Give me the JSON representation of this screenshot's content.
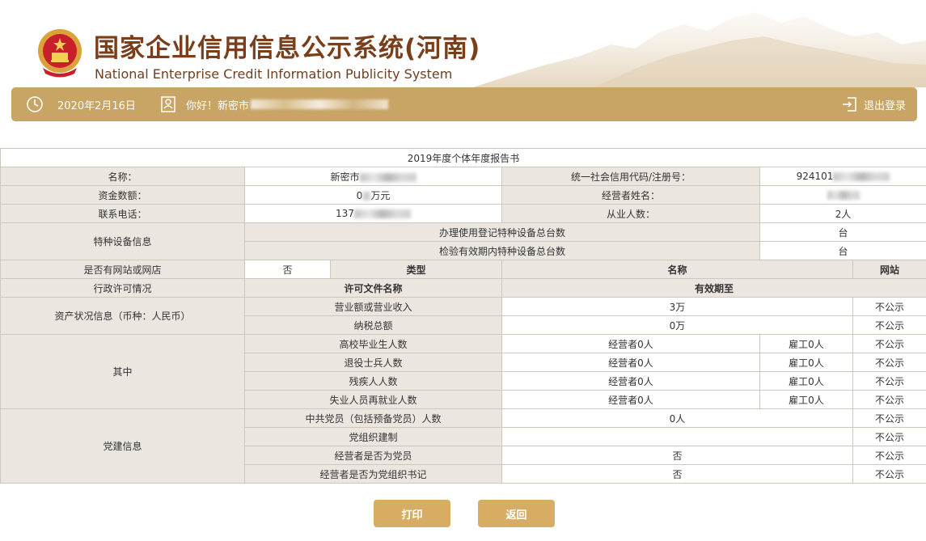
{
  "header": {
    "title_cn": "国家企业信用信息公示系统(河南)",
    "title_en": "National Enterprise Credit Information Publicity System"
  },
  "topbar": {
    "date": "2020年2月16日",
    "greeting": "你好！新密市",
    "logout": "退出登录"
  },
  "report": {
    "caption": "2019年度个体年度报告书",
    "name_label": "名称：",
    "name_value": "新密市",
    "credit_code_label": "统一社会信用代码/注册号：",
    "credit_code_value": "924101",
    "capital_label": "资金数额：",
    "capital_value_prefix": "0",
    "capital_value_suffix": "万元",
    "operator_label": "经营者姓名：",
    "phone_label": "联系电话：",
    "phone_value": "137",
    "employees_label": "从业人数：",
    "employees_value": "2人",
    "special_equipment_label": "特种设备信息",
    "special_equipment_rows": [
      {
        "label": "办理使用登记特种设备总台数",
        "value": "台"
      },
      {
        "label": "检验有效期内特种设备总台数",
        "value": "台"
      }
    ],
    "website_label": "是否有网站或网店",
    "website_value": "否",
    "website_headers": [
      "类型",
      "名称",
      "网站"
    ],
    "license_label": "行政许可情况",
    "license_headers": [
      "许可文件名称",
      "有效期至"
    ],
    "assets_label": "资产状况信息（币种：人民币）",
    "assets_rows": [
      {
        "label": "营业额或营业收入",
        "value": "3万",
        "status": "不公示"
      },
      {
        "label": "纳税总额",
        "value": "0万",
        "status": "不公示"
      }
    ],
    "among_label": "其中",
    "among_rows": [
      {
        "label": "高校毕业生人数",
        "operator": "经营者0人",
        "employee": "雇工0人",
        "status": "不公示"
      },
      {
        "label": "退役士兵人数",
        "operator": "经营者0人",
        "employee": "雇工0人",
        "status": "不公示"
      },
      {
        "label": "残疾人人数",
        "operator": "经营者0人",
        "employee": "雇工0人",
        "status": "不公示"
      },
      {
        "label": "失业人员再就业人数",
        "operator": "经营者0人",
        "employee": "雇工0人",
        "status": "不公示"
      }
    ],
    "party_label": "党建信息",
    "party_rows": [
      {
        "label": "中共党员（包括预备党员）人数",
        "value": "0人",
        "status": "不公示"
      },
      {
        "label": "党组织建制",
        "value": "",
        "status": "不公示"
      },
      {
        "label": "经营者是否为党员",
        "value": "否",
        "status": "不公示"
      },
      {
        "label": "经营者是否为党组织书记",
        "value": "否",
        "status": "不公示"
      }
    ]
  },
  "buttons": {
    "print": "打印",
    "back": "返回"
  },
  "colors": {
    "bar": "#c8a465",
    "button": "#d7ad63",
    "title": "#7a3e1a",
    "label_bg": "#ece6e1"
  }
}
